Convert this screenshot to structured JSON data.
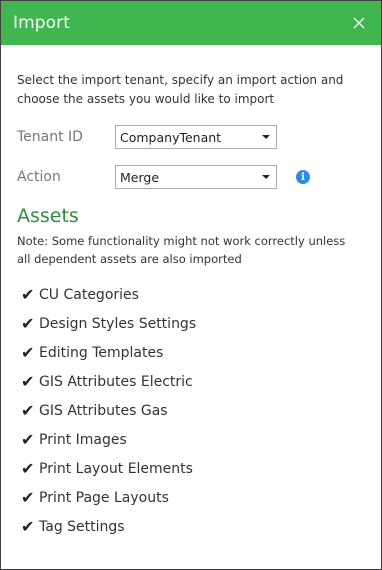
{
  "dialog": {
    "title": "Import",
    "close_icon": "close-icon"
  },
  "intro_text": "Select the import tenant, specify an import action and choose the assets you would like to import",
  "form": {
    "tenant_label": "Tenant ID",
    "tenant_value": "CompanyTenant",
    "action_label": "Action",
    "action_value": "Merge",
    "info_glyph": "i"
  },
  "assets": {
    "heading": "Assets",
    "note": "Note: Some functionality might not work correctly unless all dependent assets are also imported",
    "check_glyph": "✔",
    "items": [
      {
        "label": "CU Categories",
        "checked": true
      },
      {
        "label": "Design Styles Settings",
        "checked": true
      },
      {
        "label": "Editing Templates",
        "checked": true
      },
      {
        "label": "GIS Attributes Electric",
        "checked": true
      },
      {
        "label": "GIS Attributes Gas",
        "checked": true
      },
      {
        "label": "Print Images",
        "checked": true
      },
      {
        "label": "Print Layout Elements",
        "checked": true
      },
      {
        "label": "Print Page Layouts",
        "checked": true
      },
      {
        "label": "Tag Settings",
        "checked": true
      }
    ]
  },
  "colors": {
    "header_bg": "#3fb64e",
    "assets_heading": "#2f8e3b",
    "info_icon": "#2a8ee8"
  }
}
